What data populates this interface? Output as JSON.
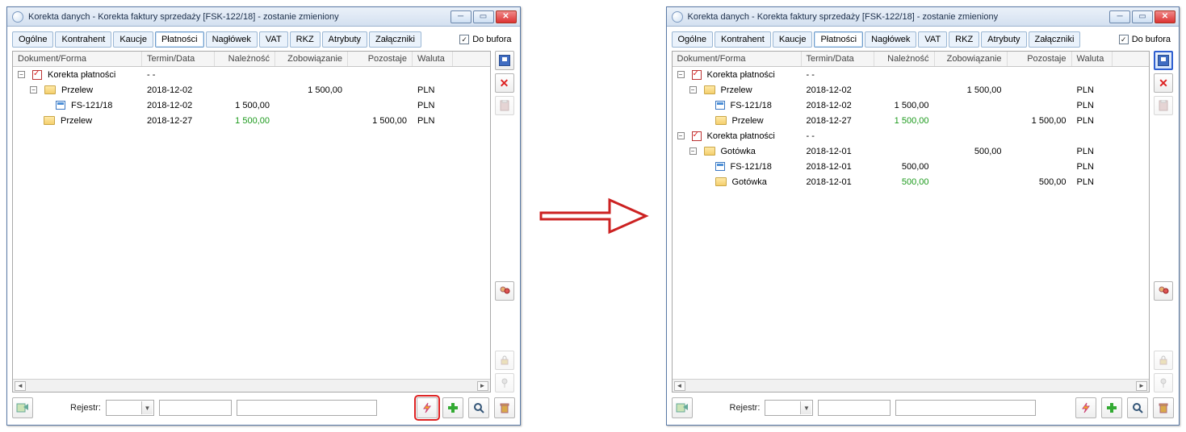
{
  "window_title": "Korekta danych - Korekta faktury sprzedaży [FSK-122/18]  - zostanie zmieniony",
  "buffer_label": "Do bufora",
  "buffer_checked": true,
  "tabs": [
    "Ogólne",
    "Kontrahent",
    "Kaucje",
    "Płatności",
    "Nagłówek",
    "VAT",
    "RKZ",
    "Atrybuty",
    "Załączniki"
  ],
  "active_tab_index": 3,
  "columns": {
    "doc": "Dokument/Forma",
    "term": "Termin/Data",
    "nal": "Należność",
    "zob": "Zobowiązanie",
    "poz": "Pozostaje",
    "wal": "Waluta"
  },
  "bottom": {
    "rejestr_label": "Rejestr:"
  },
  "rows_left": [
    {
      "indent": 0,
      "exp": "−",
      "icon": "chk",
      "label": "Korekta płatności",
      "term": "- -",
      "nal": "",
      "zob": "",
      "poz": "",
      "wal": ""
    },
    {
      "indent": 1,
      "exp": "−",
      "icon": "folder",
      "label": "Przelew",
      "term": "2018-12-02",
      "nal": "",
      "zob": "1 500,00",
      "poz": "",
      "wal": "PLN"
    },
    {
      "indent": 2,
      "exp": "",
      "icon": "doc",
      "label": "FS-121/18",
      "term": "2018-12-02",
      "nal": "1 500,00",
      "zob": "",
      "poz": "",
      "wal": "PLN"
    },
    {
      "indent": 1,
      "exp": "",
      "icon": "folder",
      "label": "Przelew",
      "term": "2018-12-27",
      "nal": "1 500,00",
      "nal_style": "green",
      "zob": "",
      "poz": "1 500,00",
      "wal": "PLN"
    }
  ],
  "rows_right": [
    {
      "indent": 0,
      "exp": "−",
      "icon": "chk",
      "label": "Korekta płatności",
      "term": "- -",
      "nal": "",
      "zob": "",
      "poz": "",
      "wal": ""
    },
    {
      "indent": 1,
      "exp": "−",
      "icon": "folder",
      "label": "Przelew",
      "term": "2018-12-02",
      "nal": "",
      "zob": "1 500,00",
      "poz": "",
      "wal": "PLN"
    },
    {
      "indent": 2,
      "exp": "",
      "icon": "doc",
      "label": "FS-121/18",
      "term": "2018-12-02",
      "nal": "1 500,00",
      "zob": "",
      "poz": "",
      "wal": "PLN"
    },
    {
      "indent": 2,
      "exp": "",
      "icon": "folder",
      "label": "Przelew",
      "term": "2018-12-27",
      "nal": "1 500,00",
      "nal_style": "green",
      "zob": "",
      "poz": "1 500,00",
      "wal": "PLN"
    },
    {
      "indent": 0,
      "exp": "−",
      "icon": "chk",
      "label": "Korekta płatności",
      "term": "- -",
      "nal": "",
      "zob": "",
      "poz": "",
      "wal": ""
    },
    {
      "indent": 1,
      "exp": "−",
      "icon": "folder",
      "label": "Gotówka",
      "term": "2018-12-01",
      "nal": "",
      "zob": "500,00",
      "poz": "",
      "wal": "PLN"
    },
    {
      "indent": 2,
      "exp": "",
      "icon": "doc",
      "label": "FS-121/18",
      "term": "2018-12-01",
      "nal": "500,00",
      "zob": "",
      "poz": "",
      "wal": "PLN"
    },
    {
      "indent": 2,
      "exp": "",
      "icon": "folder",
      "label": "Gotówka",
      "term": "2018-12-01",
      "nal": "500,00",
      "nal_style": "green",
      "zob": "",
      "poz": "500,00",
      "wal": "PLN"
    }
  ]
}
